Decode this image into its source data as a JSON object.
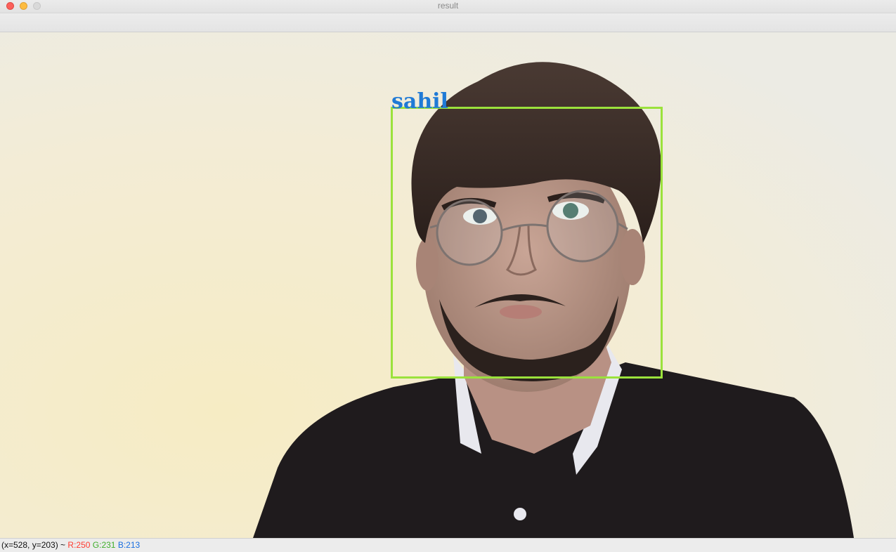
{
  "window": {
    "title": "result"
  },
  "image": {
    "detection": {
      "label": "sahil",
      "box_color": "#9be23c",
      "label_color": "#1f7ad6"
    }
  },
  "status": {
    "coords": "(x=528, y=203) ~",
    "r": "R:250",
    "g": "G:231",
    "b": "B:213"
  }
}
